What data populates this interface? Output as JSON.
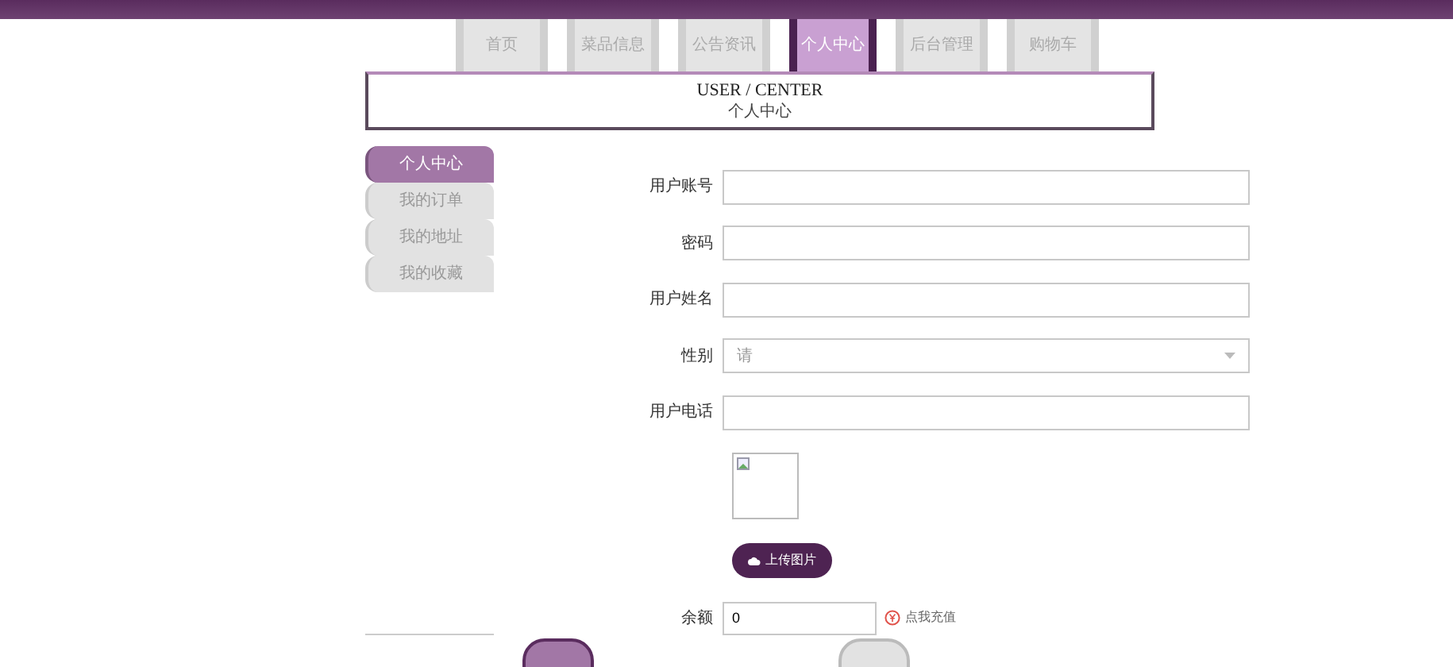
{
  "nav_tabs": [
    {
      "label": "首页",
      "selected": false
    },
    {
      "label": "菜品信息",
      "selected": false
    },
    {
      "label": "公告资讯",
      "selected": false
    },
    {
      "label": "个人中心",
      "selected": true
    },
    {
      "label": "后台管理",
      "selected": false
    },
    {
      "label": "购物车",
      "selected": false
    }
  ],
  "banner": {
    "title": "USER / CENTER",
    "subtitle": "个人中心"
  },
  "sidebar": {
    "items": [
      {
        "label": "个人中心",
        "selected": true
      },
      {
        "label": "我的订单",
        "selected": false
      },
      {
        "label": "我的地址",
        "selected": false
      },
      {
        "label": "我的收藏",
        "selected": false
      }
    ]
  },
  "form": {
    "fields": [
      {
        "kind": "text",
        "label": "用户账号"
      },
      {
        "kind": "text",
        "label": "密码"
      },
      {
        "kind": "text",
        "label": "用户姓名"
      },
      {
        "kind": "select",
        "label": "性别",
        "placeholder": "请"
      },
      {
        "kind": "text",
        "label": "用户电话"
      }
    ],
    "upload_button": "上传图片",
    "balance": {
      "label": "余额",
      "value": "0",
      "recharge_link": "点我充值"
    }
  }
}
